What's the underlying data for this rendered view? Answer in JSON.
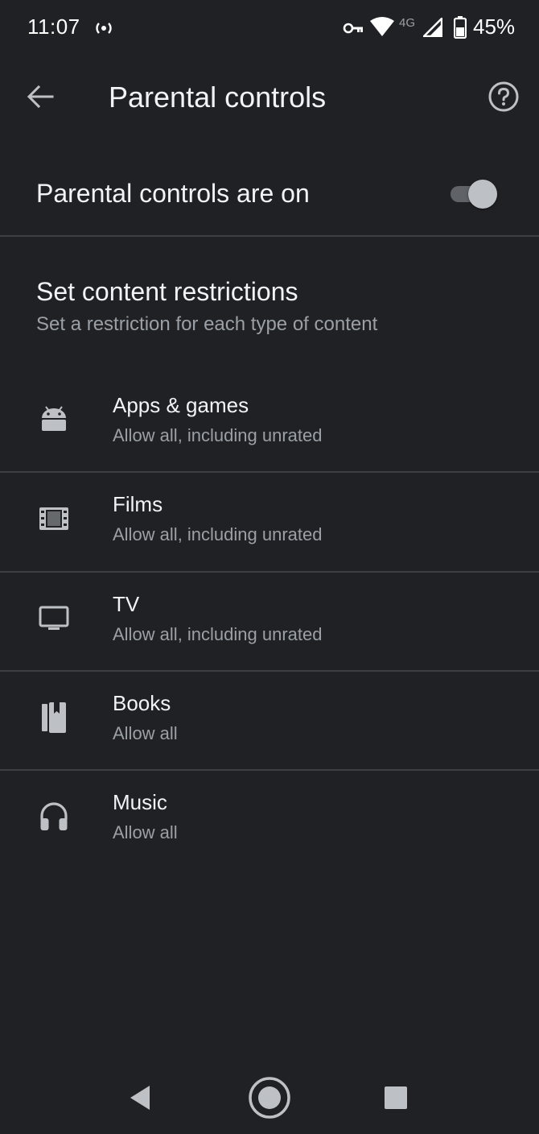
{
  "status_bar": {
    "time": "11:07",
    "network": "4G",
    "battery": "45%",
    "icons": [
      "hotspot-icon",
      "vpn-key-icon",
      "wifi-icon",
      "signal-icon",
      "battery-icon"
    ]
  },
  "app_bar": {
    "title": "Parental controls",
    "back_icon": "arrow-back-icon",
    "help_icon": "help-icon"
  },
  "master_toggle": {
    "label": "Parental controls are on",
    "checked": true
  },
  "section": {
    "title": "Set content restrictions",
    "subtitle": "Set a restriction for each type of content"
  },
  "items": [
    {
      "icon": "android-icon",
      "title": "Apps & games",
      "subtitle": "Allow all, including unrated"
    },
    {
      "icon": "film-icon",
      "title": "Films",
      "subtitle": "Allow all, including unrated"
    },
    {
      "icon": "tv-icon",
      "title": "TV",
      "subtitle": "Allow all, including unrated"
    },
    {
      "icon": "book-icon",
      "title": "Books",
      "subtitle": "Allow all"
    },
    {
      "icon": "headphones-icon",
      "title": "Music",
      "subtitle": "Allow all"
    }
  ],
  "colors": {
    "background": "#202124",
    "text_primary": "#f1f3f4",
    "text_secondary": "#9aa0a6",
    "divider": "#3c4043",
    "toggle_track": "#5f6368",
    "toggle_thumb": "#bdc1c6"
  },
  "nav_bar": {
    "icons": [
      "nav-back-icon",
      "nav-home-icon",
      "nav-recents-icon"
    ]
  }
}
